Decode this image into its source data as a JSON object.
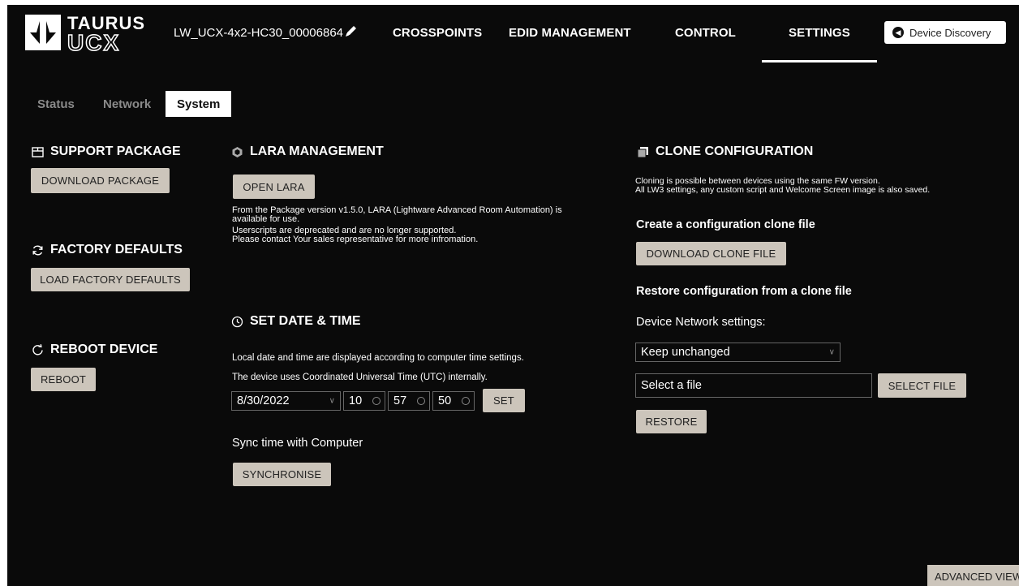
{
  "header": {
    "logo_top": "TAURUS",
    "logo_bottom": "UCX",
    "device_name": "LW_UCX-4x2-HC30_00006864",
    "nav": [
      "CROSSPOINTS",
      "EDID MANAGEMENT",
      "CONTROL",
      "SETTINGS"
    ],
    "active_nav": "SETTINGS",
    "device_discovery": "Device Discovery"
  },
  "sub_tabs": [
    "Status",
    "Network",
    "System"
  ],
  "active_sub_tab": "System",
  "support_package": {
    "title": "SUPPORT PACKAGE",
    "button": "DOWNLOAD PACKAGE"
  },
  "factory_defaults": {
    "title": "FACTORY DEFAULTS",
    "button": "LOAD FACTORY DEFAULTS"
  },
  "reboot": {
    "title": "REBOOT DEVICE",
    "button": "REBOOT"
  },
  "lara": {
    "title": "LARA MANAGEMENT",
    "button": "OPEN LARA",
    "lines": [
      "From the Package version v1.5.0, LARA (Lightware Advanced Room Automation) is",
      "available for use.",
      "Userscripts are deprecated and are no longer supported.",
      "Please contact Your sales representative for more infromation."
    ]
  },
  "datetime": {
    "title": "SET DATE & TIME",
    "line1": "Local date and time are displayed according to computer time settings.",
    "line2": "The device uses Coordinated Universal Time (UTC) internally.",
    "date": "8/30/2022",
    "hour": "10",
    "minute": "57",
    "second": "50",
    "set_button": "SET",
    "sync_label": "Sync time with Computer",
    "sync_button": "SYNCHRONISE"
  },
  "clone": {
    "title": "CLONE CONFIGURATION",
    "desc1": "Cloning is possible between devices using the same FW version.",
    "desc2": "All LW3 settings, any custom script and Welcome Screen image is also saved.",
    "create_head": "Create a configuration clone file",
    "download_button": "DOWNLOAD CLONE FILE",
    "restore_head": "Restore configuration from a clone file",
    "network_label": "Device Network settings:",
    "network_select": "Keep unchanged",
    "file_placeholder": "Select a file",
    "select_button": "SELECT FILE",
    "restore_button": "RESTORE"
  },
  "advanced_view": "ADVANCED VIEW"
}
